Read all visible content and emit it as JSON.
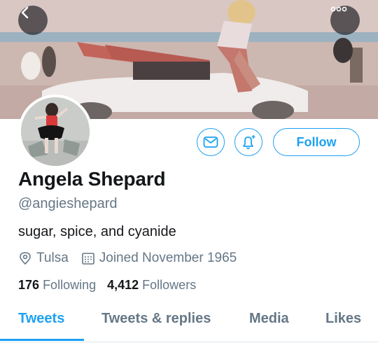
{
  "header": {
    "back_icon": "chevron-left-icon",
    "more_icon": "ellipsis-icon"
  },
  "profile": {
    "name": "Angela Shepard",
    "handle": "@angieshepard",
    "bio": "sugar, spice, and cyanide",
    "location": "Tulsa",
    "joined": "Joined November 1965",
    "following_count": "176",
    "following_label": "Following",
    "followers_count": "4,412",
    "followers_label": "Followers"
  },
  "actions": {
    "follow_label": "Follow",
    "mail_icon": "envelope-icon",
    "bell_icon": "bell-plus-icon"
  },
  "tabs": [
    {
      "label": "Tweets",
      "active": true
    },
    {
      "label": "Tweets & replies",
      "active": false
    },
    {
      "label": "Media",
      "active": false
    },
    {
      "label": "Likes",
      "active": false
    }
  ],
  "colors": {
    "accent": "#1da1f2",
    "secondary_text": "#657786",
    "primary_text": "#14171a"
  }
}
